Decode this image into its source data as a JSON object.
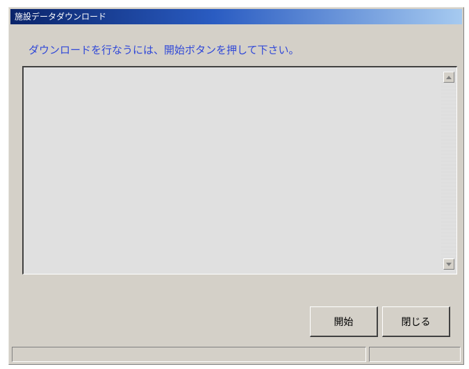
{
  "window": {
    "title": "施設データダウンロード"
  },
  "instruction_text": "ダウンロードを行なうには、開始ボタンを押して下さい。",
  "log": {
    "content": "",
    "scroll_up_icon": "arrow-up-icon",
    "scroll_down_icon": "arrow-down-icon"
  },
  "buttons": {
    "start_label": "開始",
    "close_label": "閉じる"
  },
  "statusbar": {
    "main_text": "",
    "side_text": ""
  },
  "colors": {
    "title_gradient_start": "#0a246a",
    "title_gradient_end": "#a6caf0",
    "instruction_text": "#3048d8",
    "dialog_face": "#d4d0c8"
  }
}
